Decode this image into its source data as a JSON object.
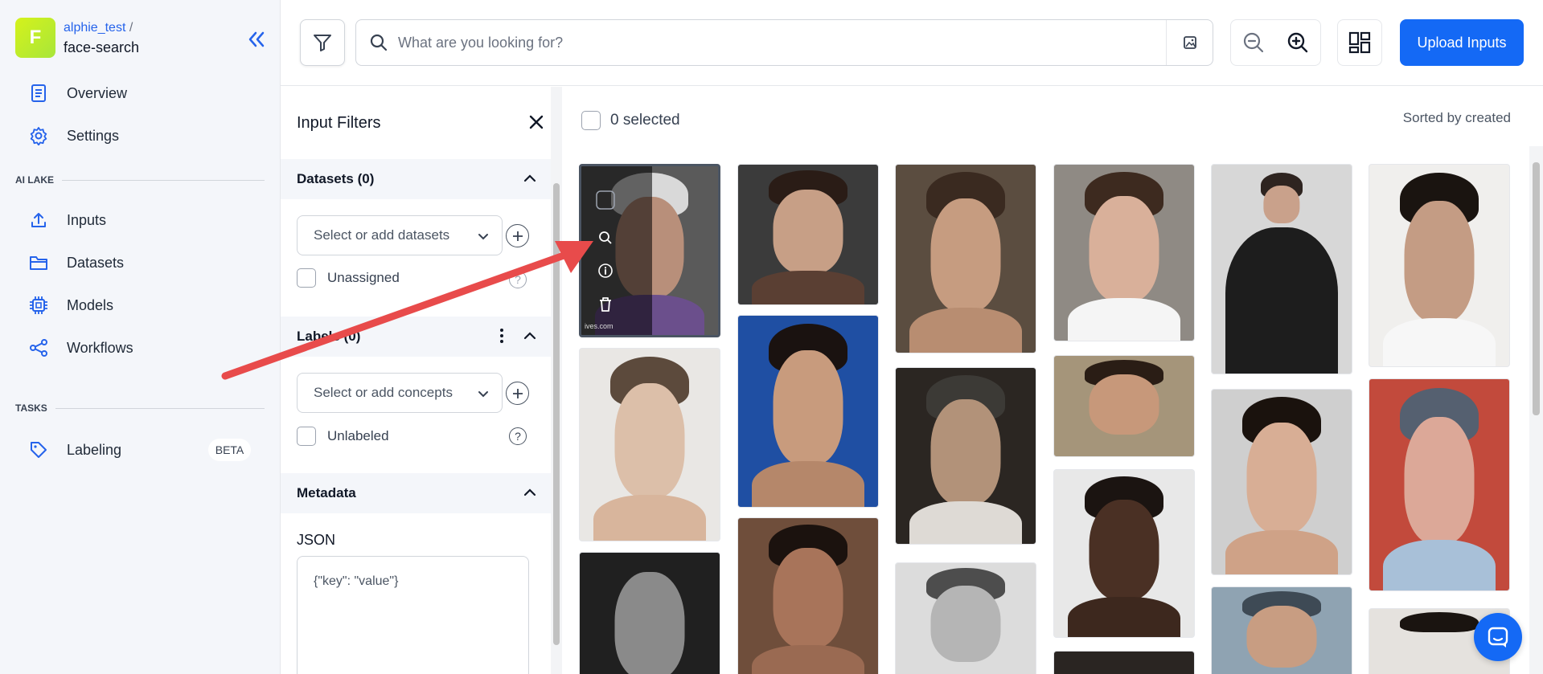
{
  "project": {
    "avatar_letter": "F",
    "user": "alphie_test",
    "separator": "/",
    "app": "face-search"
  },
  "nav": {
    "overview": "Overview",
    "settings": "Settings",
    "ai_lake_label": "AI LAKE",
    "inputs": "Inputs",
    "datasets": "Datasets",
    "models": "Models",
    "workflows": "Workflows",
    "tasks_label": "TASKS",
    "labeling": "Labeling",
    "labeling_badge": "BETA"
  },
  "search": {
    "placeholder": "What are you looking for?"
  },
  "toolbar": {
    "upload_label": "Upload Inputs"
  },
  "filters": {
    "title": "Input Filters",
    "datasets_header": "Datasets (0)",
    "datasets_placeholder": "Select or add datasets",
    "unassigned": "Unassigned",
    "labels_header": "Labels (0)",
    "concepts_placeholder": "Select or add concepts",
    "unlabeled": "Unlabeled",
    "metadata_header": "Metadata",
    "json_label": "JSON",
    "json_placeholder": "{\"key\": \"value\"}"
  },
  "gallery": {
    "selected_text": "0 selected",
    "sort_text": "Sorted by created",
    "hover_watermark": "ives.com"
  },
  "colors": {
    "accent": "#1469f5",
    "annotation_arrow": "#e84b4b"
  }
}
